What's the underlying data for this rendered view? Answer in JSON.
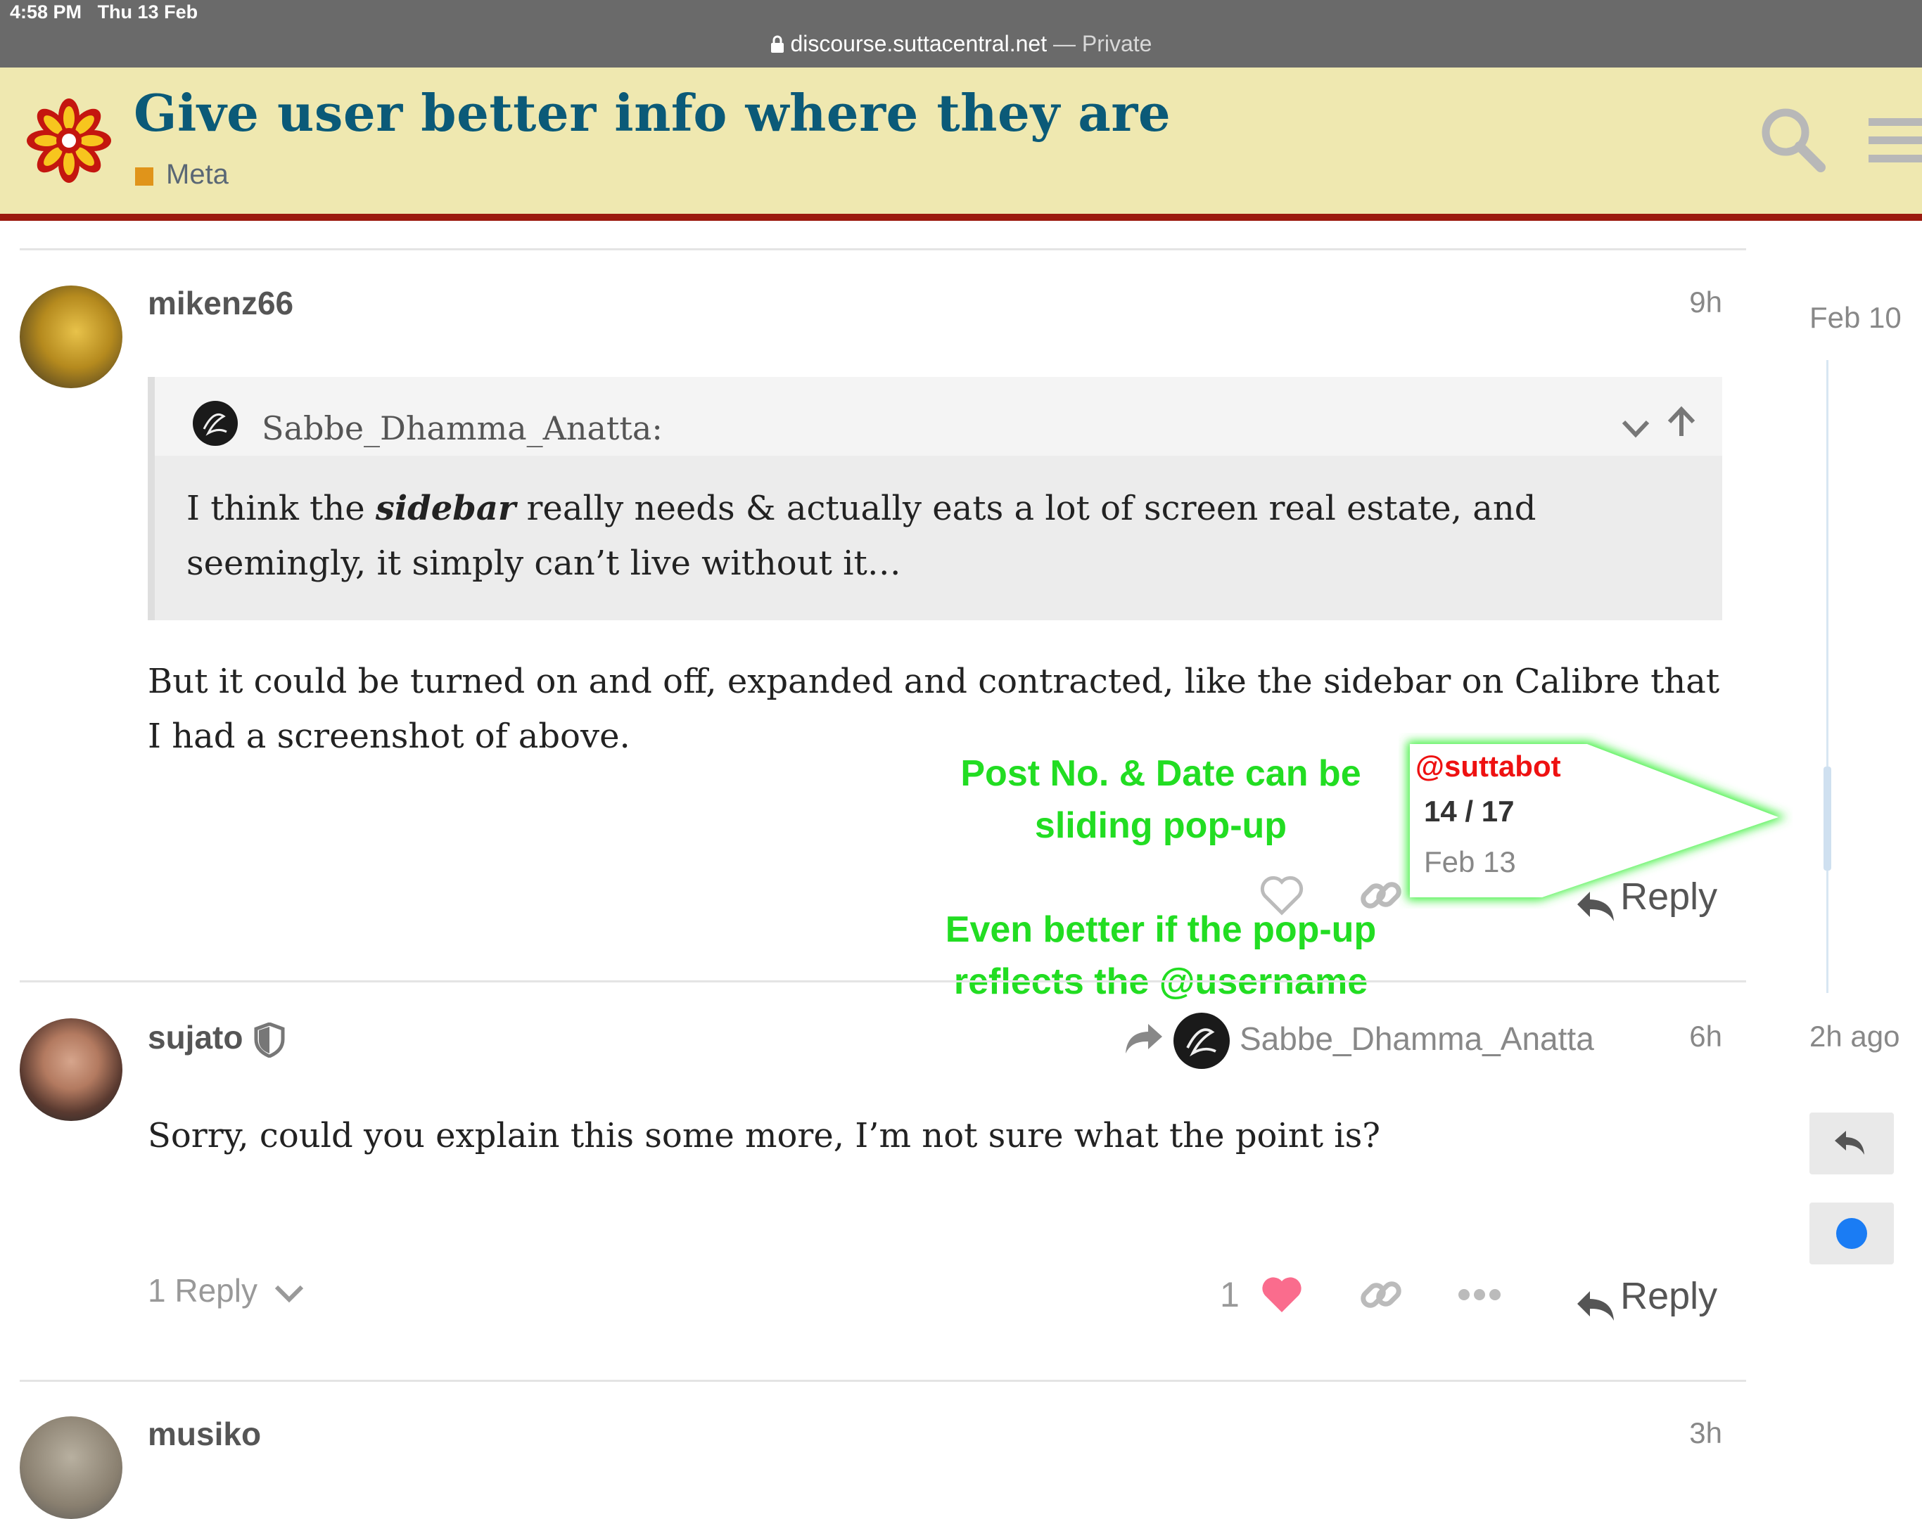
{
  "status": {
    "time": "4:58 PM",
    "date": "Thu 13 Feb"
  },
  "address": {
    "host": "discourse.suttacentral.net",
    "separator": " — ",
    "mode": "Private"
  },
  "topic": {
    "title": "Give user better info where they are",
    "category": "Meta",
    "category_color": "#e0941a"
  },
  "posts": [
    {
      "username": "mikenz66",
      "time": "9h",
      "quote": {
        "author": "Sabbe_Dhamma_Anatta:",
        "text_before": "I think the ",
        "text_em": "sidebar",
        "text_after": " really needs & actually eats a lot of screen real estate, and seemingly, it simply can’t live without it…"
      },
      "body": "But it could be turned on and off, expanded and contracted, like the sidebar on Calibre that I had a screenshot of above.",
      "reply_label": "Reply"
    },
    {
      "username": "sujato",
      "reply_to": "Sabbe_Dhamma_Anatta",
      "time": "6h",
      "body": "Sorry, could you explain this some more, I’m not sure what the point is?",
      "replies_label": "1 Reply",
      "like_count": "1",
      "reply_label": "Reply"
    },
    {
      "username": "musiko",
      "time": "3h"
    }
  ],
  "annotations": {
    "line1": "Post No. & Date can be",
    "line2": "sliding pop-up",
    "line3": "Even better if the pop-up",
    "line4": "reflects the @username"
  },
  "popup": {
    "user": "@suttabot",
    "count": "14 / 17",
    "date": "Feb 13"
  },
  "timeline": {
    "start": "Feb 10",
    "end": "2h ago"
  },
  "colors": {
    "title": "#0b5a78",
    "header_bg": "#efe8b0",
    "header_border": "#9b1a0f",
    "annotation": "#22dd22",
    "heart": "#fa6c8d",
    "unread_dot": "#1a7cf4"
  }
}
